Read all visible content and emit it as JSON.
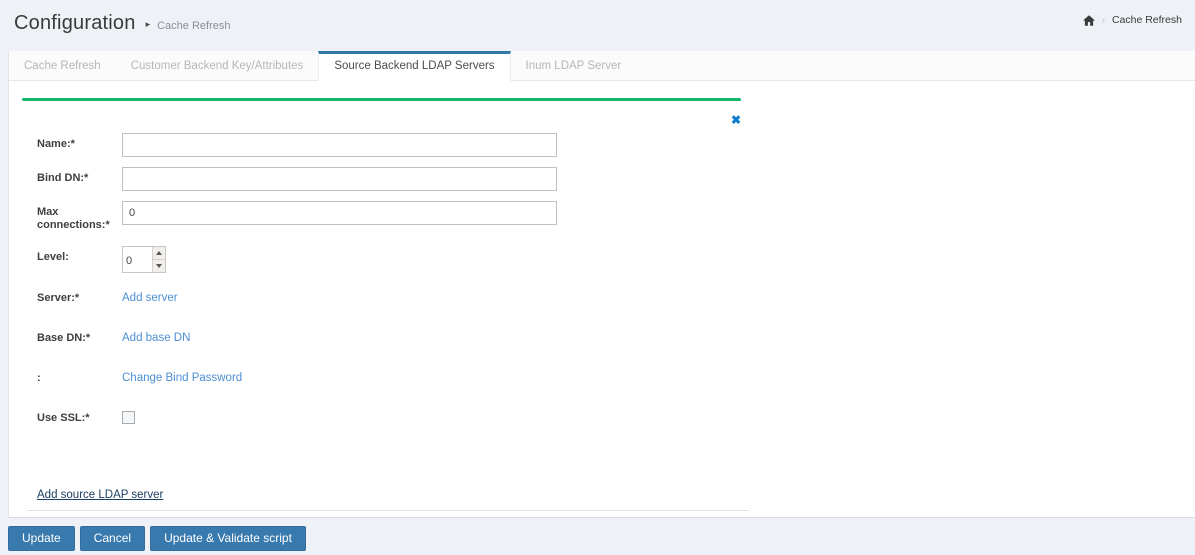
{
  "header": {
    "title": "Configuration",
    "title_caret": "▸",
    "subtitle": "Cache Refresh",
    "breadcrumb": {
      "separator": "›",
      "item": "Cache Refresh"
    }
  },
  "tabs": [
    {
      "label": "Cache Refresh",
      "active": false
    },
    {
      "label": "Customer Backend Key/Attributes",
      "active": false
    },
    {
      "label": "Source Backend LDAP Servers",
      "active": true
    },
    {
      "label": "Inum LDAP Server",
      "active": false
    }
  ],
  "form": {
    "close_glyph": "✖",
    "fields": {
      "name": {
        "label": "Name:*",
        "value": ""
      },
      "bind_dn": {
        "label": "Bind DN:*",
        "value": ""
      },
      "max_connections": {
        "label": "Max connections:*",
        "value": "0"
      },
      "level": {
        "label": "Level:",
        "value": "0"
      },
      "server": {
        "label": "Server:*",
        "link": "Add server"
      },
      "base_dn": {
        "label": "Base DN:*",
        "link": "Add base DN"
      },
      "bind_password": {
        "label": ":",
        "link": "Change Bind Password"
      },
      "use_ssl": {
        "label": "Use SSL:*",
        "checked": false
      }
    },
    "add_link": "Add source LDAP server"
  },
  "footer": {
    "update_label": "Update",
    "cancel_label": "Cancel",
    "update_validate_label": "Update & Validate script"
  },
  "colors": {
    "accent_green": "#12b76a",
    "accent_blue": "#3178ab",
    "link_blue": "#4a90d2",
    "button_blue": "#3879ae",
    "close_blue": "#0f7ccd",
    "page_bg": "#eef1f5"
  }
}
